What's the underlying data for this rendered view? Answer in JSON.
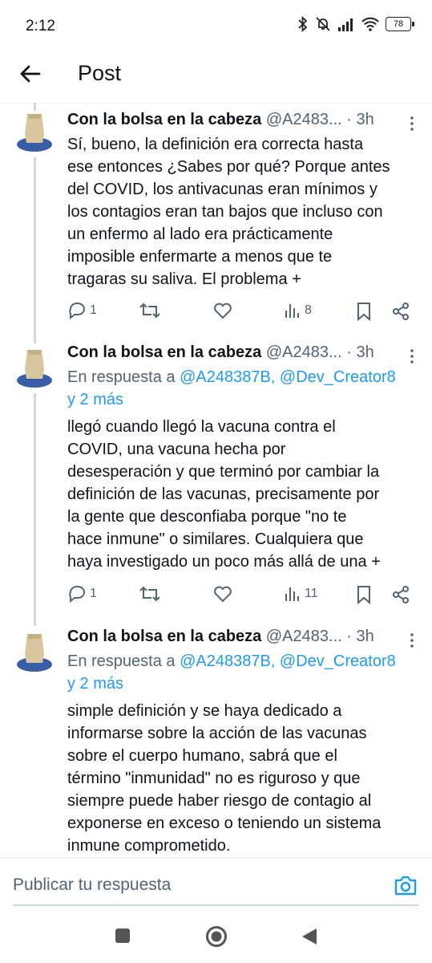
{
  "status_bar": {
    "time": "2:12",
    "battery": "78"
  },
  "header": {
    "title": "Post"
  },
  "tweets": [
    {
      "name": "Con la bolsa en la cabeza",
      "handle_meta": "@A2483... · 3h",
      "reply_prefix": "",
      "reply_mentions": "",
      "reply_more": "",
      "text_lines": [
        "Sí, bueno, la definición era correcta hasta",
        "ese entonces ¿Sabes por qué? Porque antes",
        "del COVID, los antivacunas eran mínimos y",
        "los contagios eran tan bajos que incluso con",
        "un enfermo al lado era prácticamente",
        "imposible enfermarte a menos que te",
        "tragaras su saliva. El problema +"
      ],
      "replies": "1",
      "retweets": "",
      "likes": "",
      "views": "8"
    },
    {
      "name": "Con la bolsa en la cabeza",
      "handle_meta": "@A2483... · 3h",
      "reply_prefix": "En respuesta a ",
      "reply_mentions": "@A248387B, @Dev_Creator8",
      "reply_more": "y 2 más",
      "text_lines": [
        "llegó cuando llegó la vacuna contra el",
        "COVID, una vacuna hecha por",
        "desesperación y que terminó por cambiar la",
        "definición de las vacunas, precisamente por",
        "la gente que desconfiaba porque \"no te",
        "hace inmune\" o similares. Cualquiera que",
        "haya investigado un poco más allá de una +"
      ],
      "replies": "1",
      "retweets": "",
      "likes": "",
      "views": "11"
    },
    {
      "name": "Con la bolsa en la cabeza",
      "handle_meta": "@A2483... · 3h",
      "reply_prefix": "En respuesta a ",
      "reply_mentions": "@A248387B, @Dev_Creator8",
      "reply_more": "y 2 más",
      "text_lines": [
        "simple definición y se haya dedicado a",
        "informarse sobre la acción de las vacunas",
        "sobre el cuerpo humano, sabrá que el",
        "término \"inmunidad\" no es riguroso y que",
        "siempre puede haber riesgo de contagio al",
        "exponerse en exceso o teniendo un sistema",
        "inmune comprometido."
      ]
    }
  ],
  "composer": {
    "placeholder": "Publicar tu respuesta"
  },
  "icons": {
    "back": "arrow-left-icon",
    "more": "more-vertical-icon",
    "reply": "comment-icon",
    "retweet": "retweet-icon",
    "like": "heart-icon",
    "views": "bar-chart-icon",
    "bookmark": "bookmark-icon",
    "share": "share-icon",
    "camera": "camera-icon"
  },
  "colors": {
    "accent": "#1d9bf0",
    "secondary_text": "#536471",
    "thread_line": "#cfd9de"
  }
}
